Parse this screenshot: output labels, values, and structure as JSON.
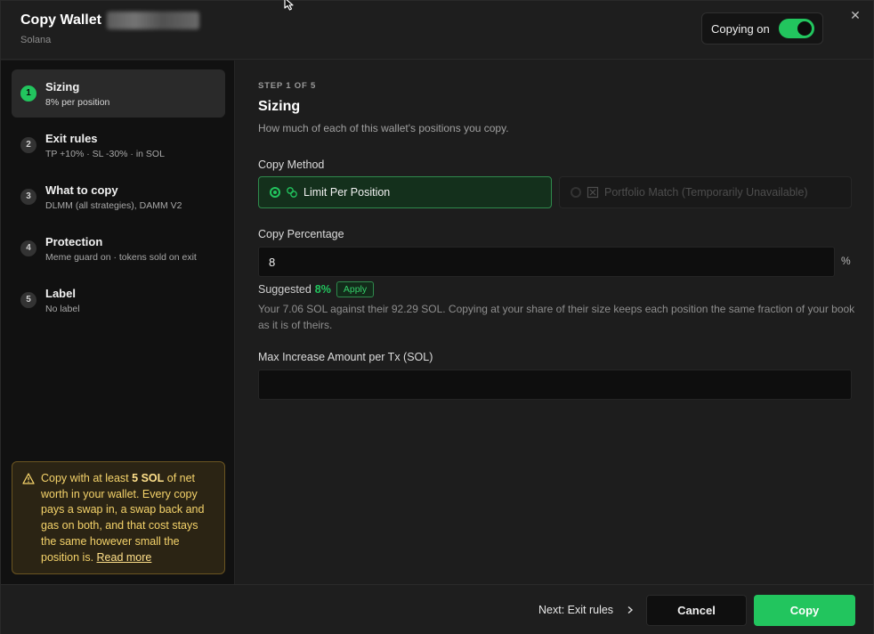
{
  "header": {
    "title": "Copy Wallet",
    "subtitle": "Solana",
    "toggle_label": "Copying on",
    "toggle_on": true,
    "close_label": "✕"
  },
  "sidebar": {
    "steps": [
      {
        "num": "1",
        "title": "Sizing",
        "sub": "8% per position",
        "active": true
      },
      {
        "num": "2",
        "title": "Exit rules",
        "sub": "TP +10% · SL -30% · in SOL"
      },
      {
        "num": "3",
        "title": "What to copy",
        "sub": "DLMM (all strategies), DAMM V2"
      },
      {
        "num": "4",
        "title": "Protection",
        "sub": "Meme guard on · tokens sold on exit"
      },
      {
        "num": "5",
        "title": "Label",
        "sub": "No label"
      }
    ],
    "warning": {
      "pre": "Copy with at least ",
      "bold": "5 SOL",
      "post": " of net worth in your wallet. Every copy pays a swap in, a swap back and gas on both, and that cost stays the same however small the position is. ",
      "link": "Read more"
    }
  },
  "main": {
    "step_label": "STEP 1 OF 5",
    "title": "Sizing",
    "description": "How much of each of this wallet's positions you copy.",
    "copy_method_label": "Copy Method",
    "method_limit": "Limit Per Position",
    "method_portfolio": "Portfolio Match (Temporarily Unavailable)",
    "copy_percentage_label": "Copy Percentage",
    "copy_percentage_value": "8",
    "percent_sign": "%",
    "suggested_label": "Suggested",
    "suggested_value": "8%",
    "apply_label": "Apply",
    "explanation": "Your 7.06 SOL against their 92.29 SOL. Copying at your share of their size keeps each position the same fraction of your book as it is of theirs.",
    "max_increase_label": "Max Increase Amount per Tx (SOL)",
    "max_increase_value": ""
  },
  "footer": {
    "next_label": "Next: Exit rules",
    "cancel_label": "Cancel",
    "copy_label": "Copy"
  },
  "colors": {
    "accent": "#22c55e",
    "warning_text": "#f5d36a",
    "background": "#1d1d1d"
  }
}
